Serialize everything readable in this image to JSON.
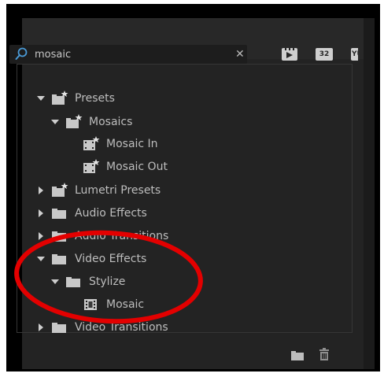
{
  "search": {
    "value": "mosaic"
  },
  "toolbar": {
    "accel_label": "",
    "bit32_label": "32",
    "yuv_label": "YUV"
  },
  "tree": {
    "presets": "Presets",
    "mosaics": "Mosaics",
    "mosaic_in": "Mosaic In",
    "mosaic_out": "Mosaic Out",
    "lumetri_presets": "Lumetri Presets",
    "audio_effects": "Audio Effects",
    "audio_transitions": "Audio Transitions",
    "video_effects": "Video Effects",
    "stylize": "Stylize",
    "mosaic": "Mosaic",
    "video_transitions": "Video Transitions"
  },
  "colors": {
    "panel_bg": "#232323",
    "text": "#bdbdbd",
    "search_icon": "#4a9ad6",
    "annotation": "#e30000"
  },
  "icons": {
    "search": "magnifier-icon",
    "clear": "close-icon",
    "preset_folder": "preset-bin-star-icon",
    "folder": "folder-icon",
    "preset_item": "preset-star-icon",
    "effect": "effect-filmstrip-icon",
    "new_bin": "new-bin-icon",
    "delete": "trash-icon"
  }
}
